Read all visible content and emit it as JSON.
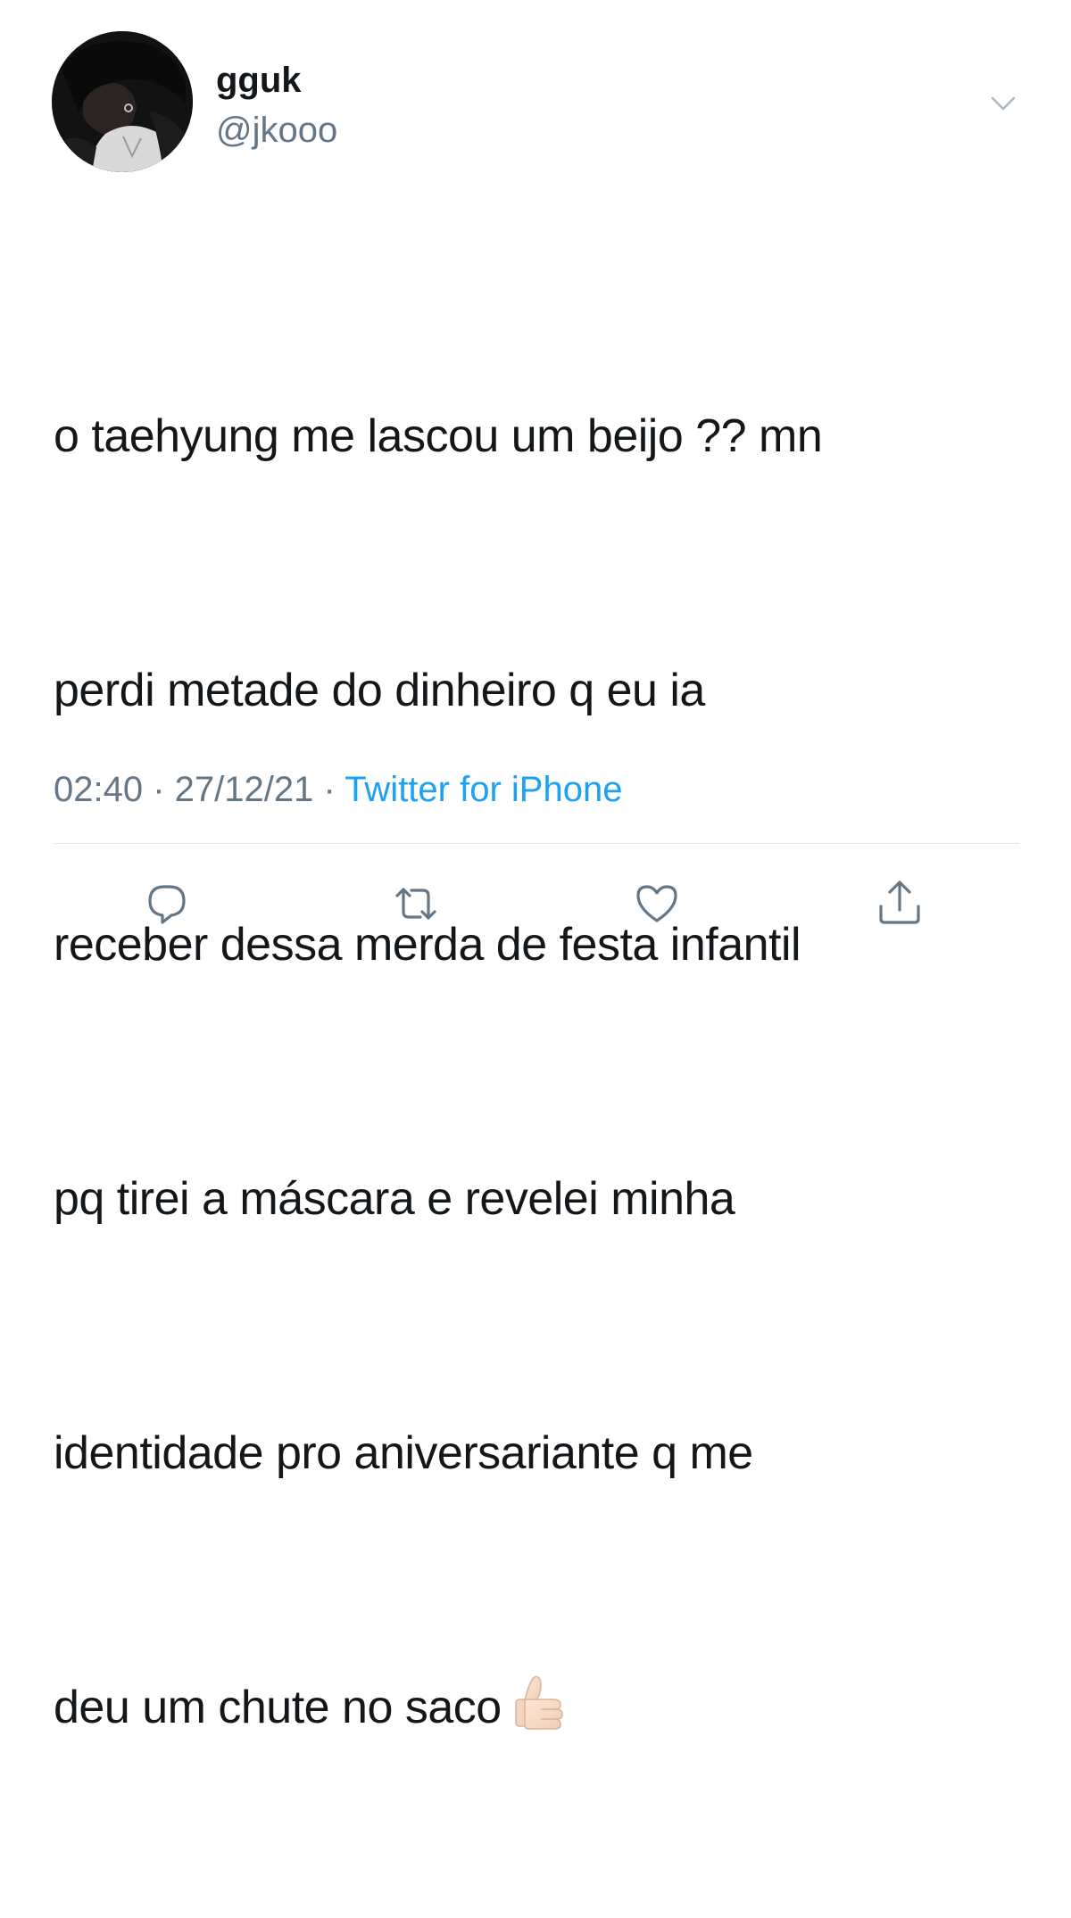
{
  "user": {
    "display_name": "gguk",
    "handle": "@jkooo"
  },
  "tweet": {
    "lines": [
      "o taehyung me lascou um beijo ?? mn",
      "perdi metade do dinheiro q eu ia",
      "receber dessa merda de festa infantil",
      "pq tirei a máscara e revelei minha",
      "identidade pro aniversariante q me",
      "deu um chute no saco"
    ],
    "emoji": "👍🏻"
  },
  "meta": {
    "time": "02:40",
    "separator1": " · ",
    "date": "27/12/21",
    "separator2": " · ",
    "source": "Twitter for iPhone"
  },
  "icons": {
    "more": "chevron-down-icon",
    "reply": "reply-icon",
    "retweet": "retweet-icon",
    "like": "heart-icon",
    "share": "share-icon"
  },
  "colors": {
    "text": "#14171a",
    "secondary": "#657786",
    "link": "#1da1f2",
    "divider": "#e1e8ed",
    "icon": "#657786"
  }
}
